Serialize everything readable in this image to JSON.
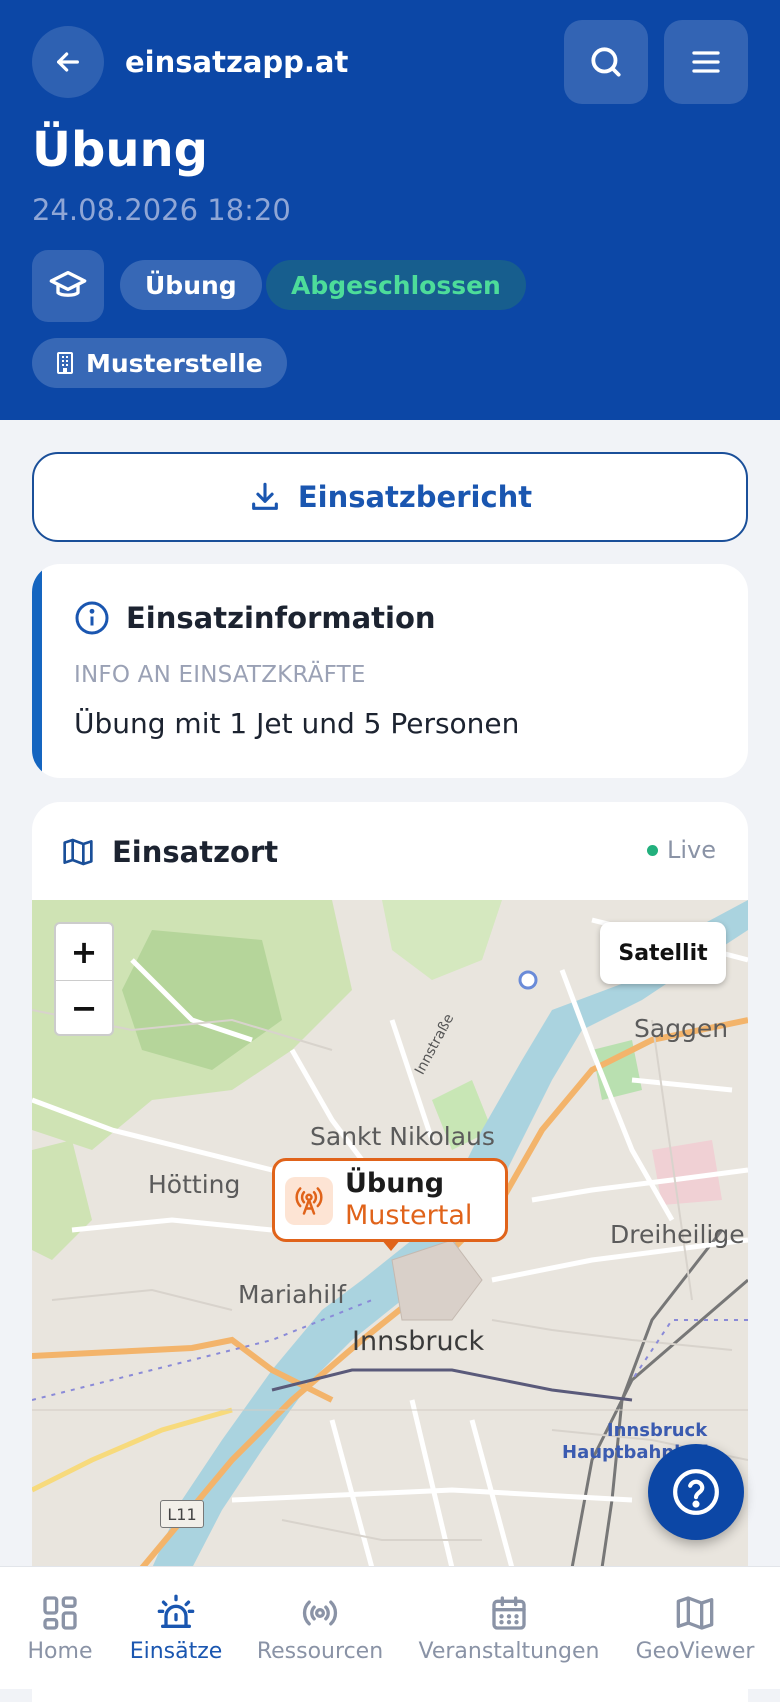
{
  "header": {
    "app_title": "einsatzapp.at",
    "title": "Übung",
    "date": "24.08.2026 18:20",
    "chips": {
      "type": "Übung",
      "status": "Abgeschlossen",
      "location": "Musterstelle"
    }
  },
  "report_button": {
    "label": "Einsatzbericht"
  },
  "info_card": {
    "title": "Einsatzinformation",
    "section_label": "INFO AN EINSATZKRÄFTE",
    "text": "Übung mit 1 Jet und 5 Personen"
  },
  "map_card": {
    "title": "Einsatzort",
    "live_label": "Live",
    "satellite_label": "Satellit",
    "zoom_in": "+",
    "zoom_out": "−",
    "marker": {
      "title": "Übung",
      "subtitle": "Mustertal"
    },
    "places": {
      "saggen": "Saggen",
      "sankt_nikolaus": "Sankt Nikolaus",
      "hoetting": "Hötting",
      "mariahilf": "Mariahilf",
      "dreiheilige": "Dreiheilige",
      "innsbruck": "Innsbruck",
      "hauptbahnhof_1": "Innsbruck",
      "hauptbahnhof_2": "Hauptbahnhof",
      "innstrasse": "Innstraße",
      "l11": "L11"
    }
  },
  "bottom_nav": [
    {
      "label": "Home"
    },
    {
      "label": "Einsätze"
    },
    {
      "label": "Ressourcen"
    },
    {
      "label": "Veranstaltungen"
    },
    {
      "label": "GeoViewer"
    }
  ],
  "colors": {
    "header_bg": "#0c47a6",
    "accent_blue": "#1a56b0",
    "status_green": "#4ddc9a",
    "marker_orange": "#e0631a",
    "live_dot": "#22b07d"
  }
}
